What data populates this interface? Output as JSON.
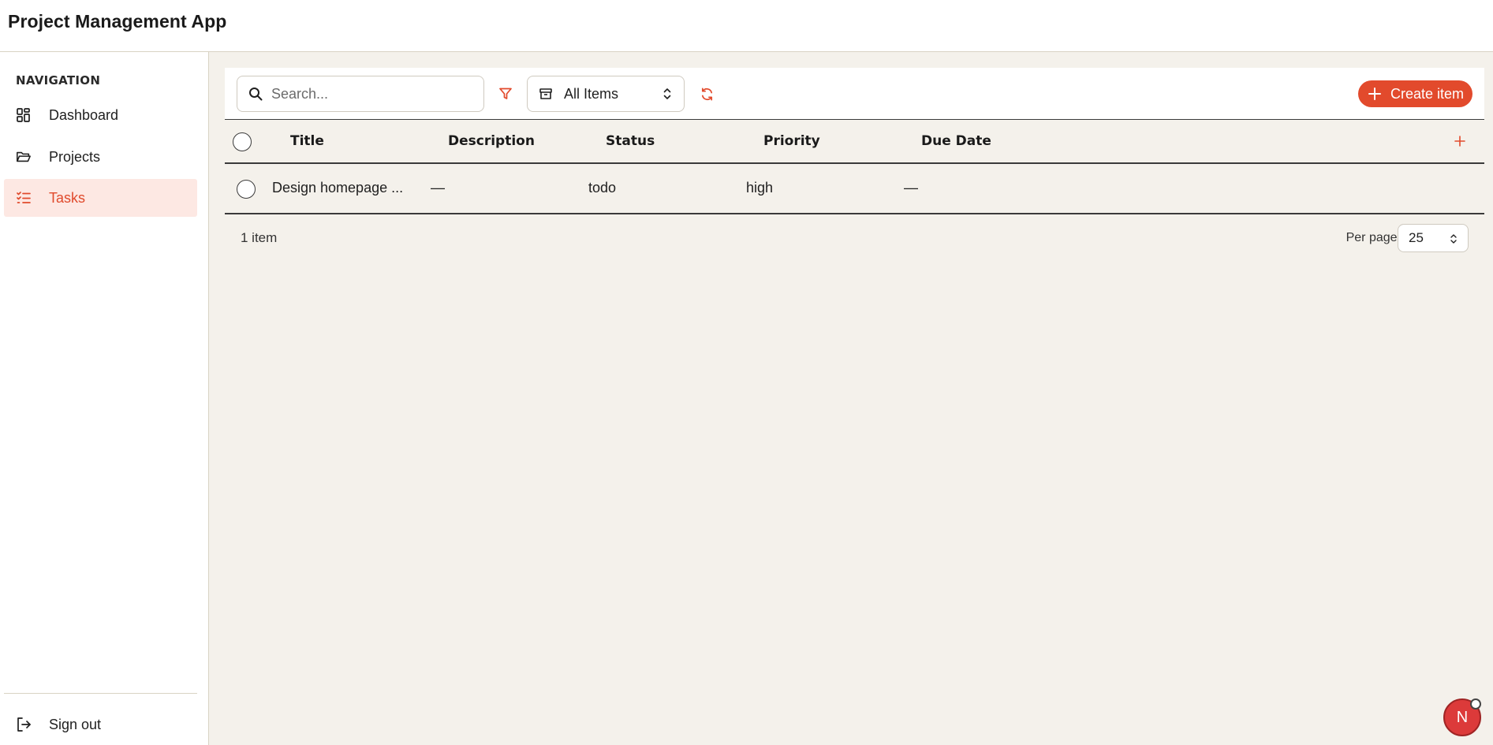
{
  "app": {
    "title": "Project Management App"
  },
  "sidebar": {
    "heading": "NAVIGATION",
    "items": [
      {
        "label": "Dashboard",
        "icon": "dashboard-icon",
        "active": false
      },
      {
        "label": "Projects",
        "icon": "folder-icon",
        "active": false
      },
      {
        "label": "Tasks",
        "icon": "tasks-list-icon",
        "active": true
      }
    ],
    "signout_label": "Sign out"
  },
  "toolbar": {
    "search_placeholder": "Search...",
    "filter_icon": "filter-icon",
    "view_select_value": "All Items",
    "refresh_icon": "refresh-icon",
    "create_label": "Create item"
  },
  "colors": {
    "accent": "#e24a2c",
    "active_bg": "#fde8e3",
    "main_bg": "#f4f1eb"
  },
  "table": {
    "columns": [
      "Title",
      "Description",
      "Status",
      "Priority",
      "Due Date"
    ],
    "rows": [
      {
        "title": "Design homepage ...",
        "description": "—",
        "status": "todo",
        "priority": "high",
        "due_date": "—"
      }
    ]
  },
  "footer": {
    "count_text": "1 item",
    "per_page_label": "Per page:",
    "per_page_value": "25"
  },
  "user": {
    "avatar_initial": "N"
  }
}
